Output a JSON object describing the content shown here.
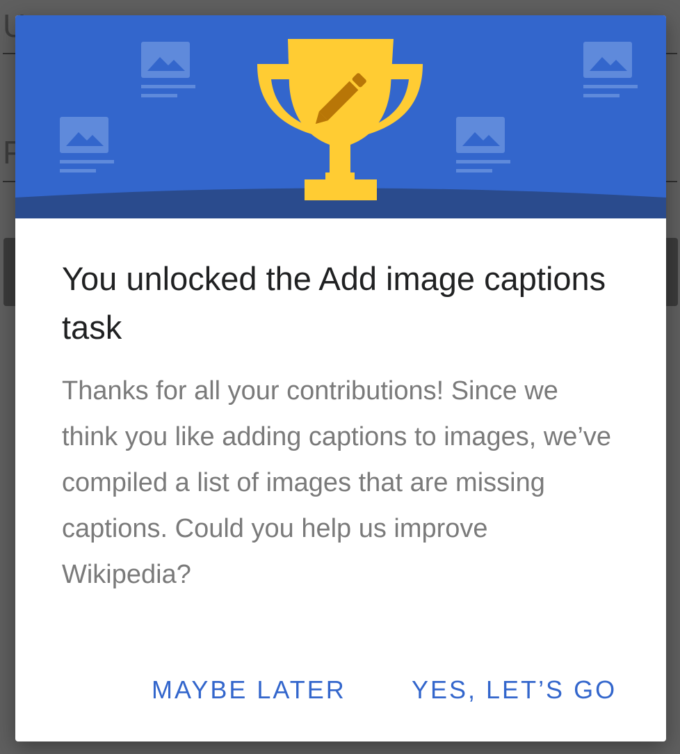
{
  "dialog": {
    "title": "You unlocked the Add image captions task",
    "body": "Thanks for all your contributions! Since we think you like adding captions to images, we’ve compiled a list of images that are missing captions. Could you help us improve Wikipedia?",
    "actions": {
      "maybe_later": "MAYBE LATER",
      "yes_lets_go": "YES, LET’S GO"
    }
  },
  "hero": {
    "icons": [
      "trophy-icon",
      "pencil-icon",
      "image-card-icon"
    ]
  },
  "background": {
    "letters": [
      "U",
      "P"
    ]
  },
  "colors": {
    "hero_blue": "#3366cc",
    "hero_dark_blue": "#2a4b8d",
    "trophy_yellow": "#ffcc33",
    "pencil_brown": "#ac6600",
    "button_blue": "#3366cc",
    "title_text": "#202122",
    "body_text": "#7a7a7a",
    "scrim": "#5f5f5f"
  }
}
